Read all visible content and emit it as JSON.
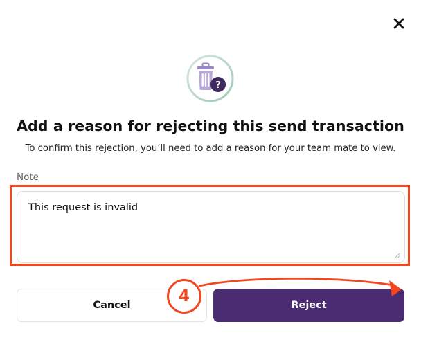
{
  "dialog": {
    "close_icon": "close-icon",
    "hero_icon": "trash-question-icon",
    "title": "Add a reason for rejecting this send transaction",
    "subtitle": "To confirm this rejection, you’ll need to add a reason for your team mate to view."
  },
  "note": {
    "label": "Note",
    "value": "This request is invalid"
  },
  "actions": {
    "cancel_label": "Cancel",
    "reject_label": "Reject"
  },
  "annotation": {
    "step_number": "4",
    "color": "#f2461f"
  },
  "colors": {
    "primary": "#4b2c73",
    "hero_accent": "#9a86c2",
    "hero_badge": "#3e2a5e"
  }
}
